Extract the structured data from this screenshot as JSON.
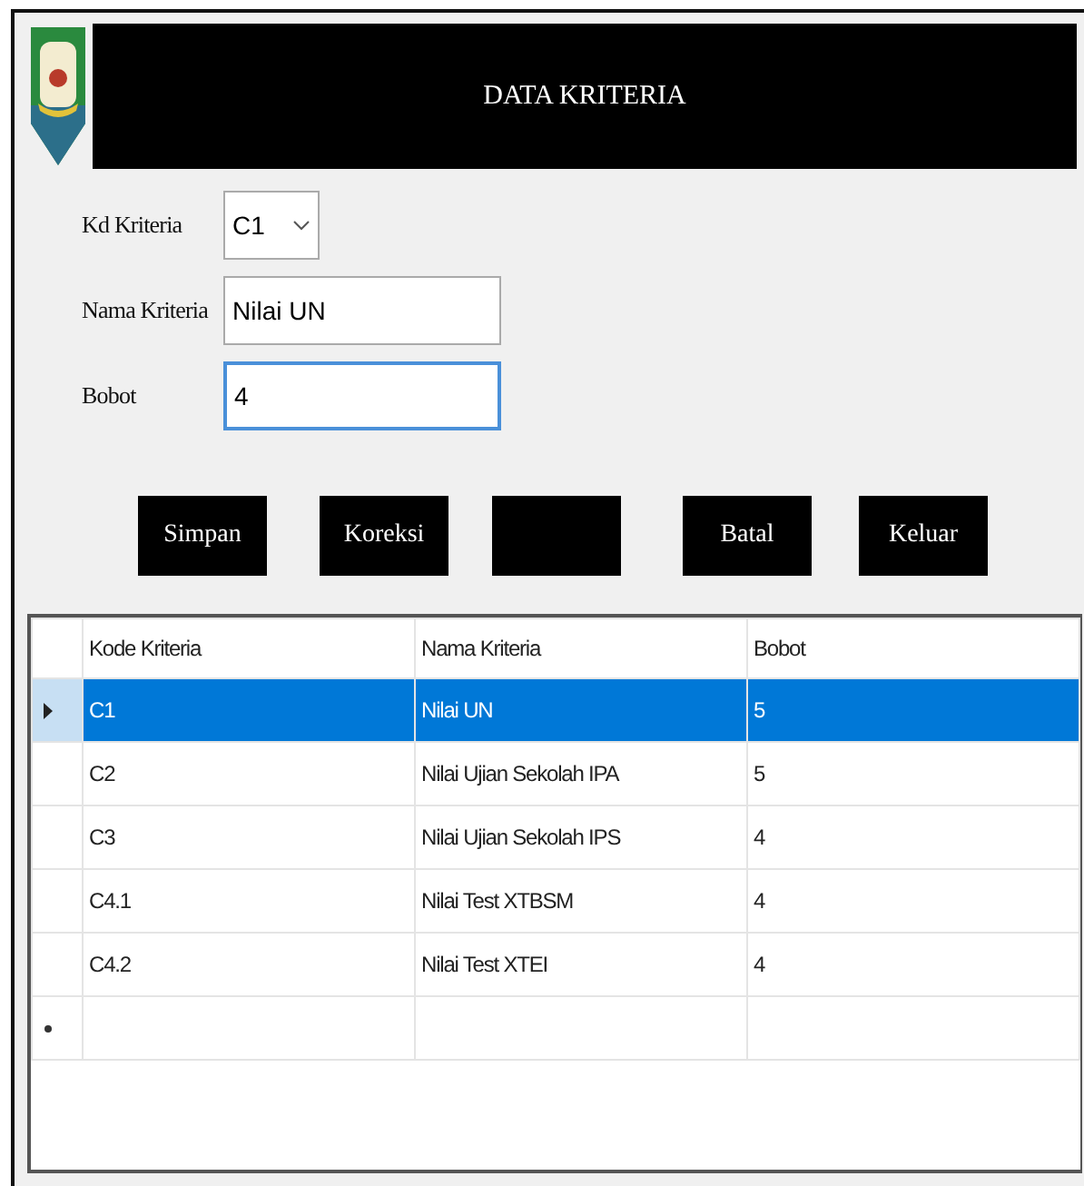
{
  "header": {
    "title": "DATA KRITERIA"
  },
  "form": {
    "fields": [
      {
        "label": "Kd Kriteria",
        "kind": "combo",
        "value": "C1",
        "focused": false
      },
      {
        "label": "Nama Kriteria",
        "kind": "text",
        "value": "Nilai UN",
        "focused": false
      },
      {
        "label": "Bobot",
        "kind": "text",
        "value": "4",
        "focused": true
      }
    ]
  },
  "buttons": [
    {
      "kind": "text",
      "label": "Simpan"
    },
    {
      "kind": "text",
      "label": "Koreksi"
    },
    {
      "kind": "blank"
    },
    {
      "kind": "text",
      "label": "Batal"
    },
    {
      "kind": "text",
      "label": "Keluar"
    }
  ],
  "table": {
    "columns": [
      "Kode Kriteria",
      "Nama Kriteria",
      "Bobot"
    ],
    "rows": [
      {
        "kind": "data",
        "selected": true,
        "cells": [
          "C1",
          "Nilai UN",
          "5"
        ]
      },
      {
        "kind": "data",
        "selected": false,
        "cells": [
          "C2",
          "Nilai Ujian Sekolah IPA",
          "5"
        ]
      },
      {
        "kind": "data",
        "selected": false,
        "cells": [
          "C3",
          "Nilai Ujian Sekolah IPS",
          "4"
        ]
      },
      {
        "kind": "data",
        "selected": false,
        "cells": [
          "C4.1",
          "Nilai Test XTBSM",
          "4"
        ]
      },
      {
        "kind": "data",
        "selected": false,
        "cells": [
          "C4.2",
          "Nilai Test XTEI",
          "4"
        ]
      },
      {
        "kind": "new",
        "selected": false,
        "cells": []
      }
    ]
  }
}
